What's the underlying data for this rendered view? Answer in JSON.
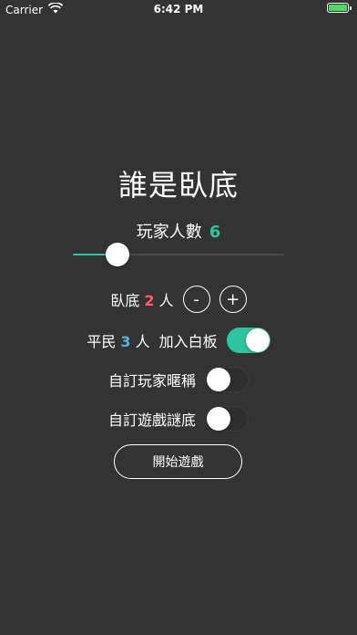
{
  "status_bar": {
    "carrier": "Carrier",
    "time": "6:42 PM",
    "wifi_icon": "wifi-icon",
    "battery_icon": "battery-icon"
  },
  "app": {
    "title": "誰是臥底",
    "player_count": {
      "label": "玩家人數",
      "value": "6",
      "slider_fraction": 0.21
    },
    "spy": {
      "label": "臥底",
      "count": "2",
      "unit": "人",
      "minus_label": "-",
      "plus_label": "+"
    },
    "civilian": {
      "label": "平民",
      "count": "3",
      "unit": "人",
      "blank_label": "加入白板",
      "blank_enabled": true
    },
    "custom_nickname": {
      "label": "自訂玩家暱稱",
      "enabled": false
    },
    "custom_words": {
      "label": "自訂遊戲謎底",
      "enabled": false
    },
    "start_button_label": "開始遊戲"
  },
  "colors": {
    "background": "#333333",
    "accent": "#2ec4a0",
    "spy_red": "#ff5f6d",
    "civilian_blue": "#5ab0e0",
    "battery_green": "#4cd964"
  }
}
